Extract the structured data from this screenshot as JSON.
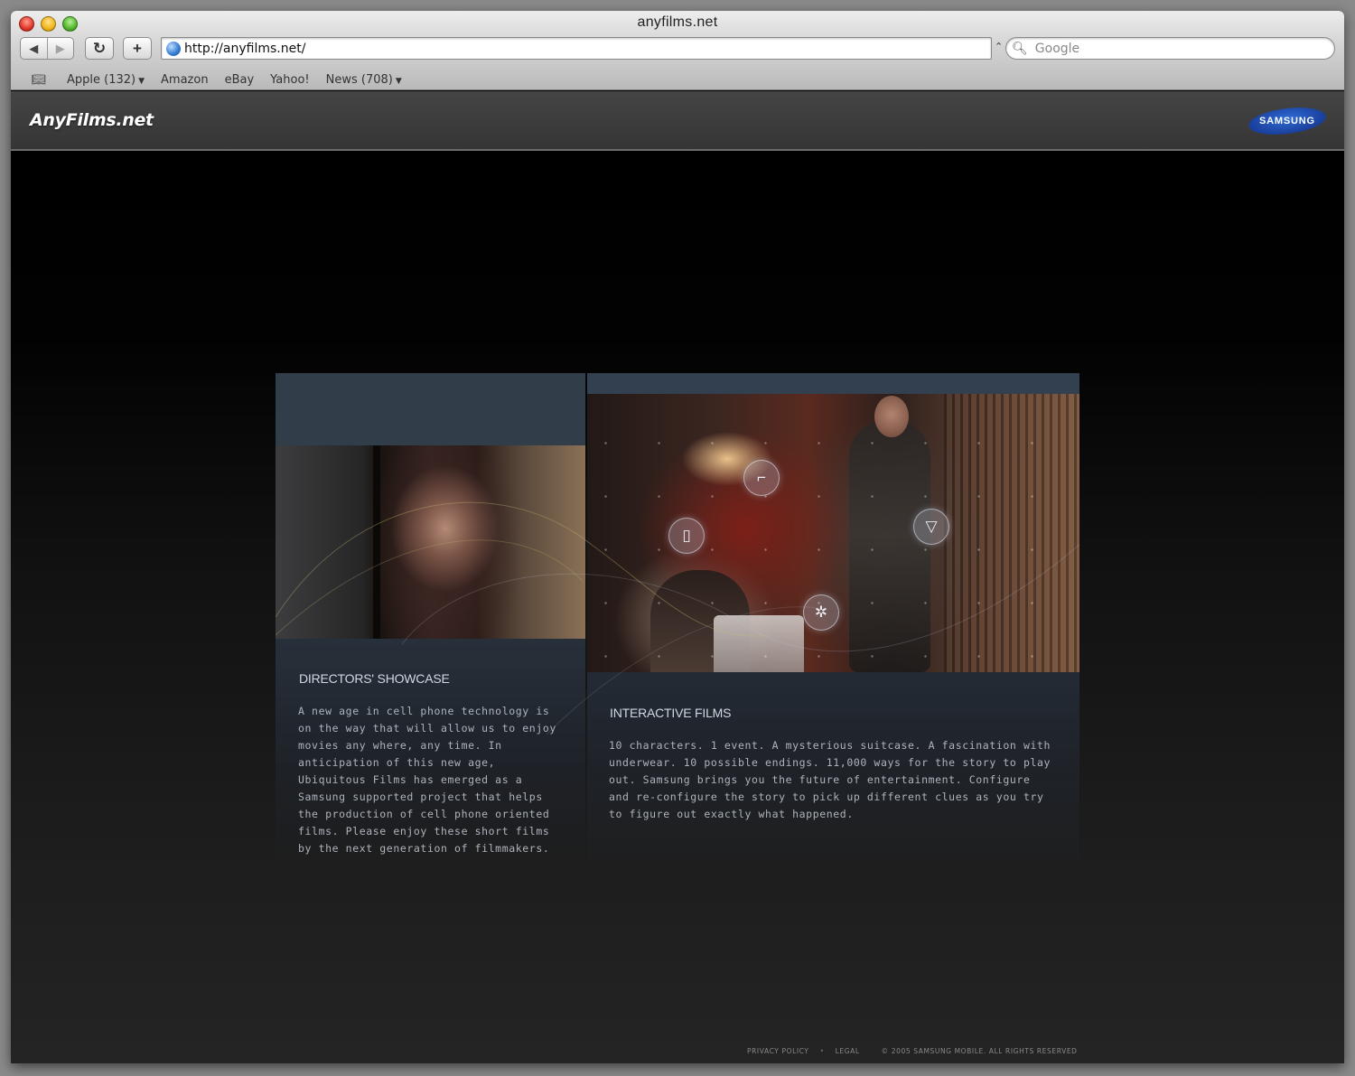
{
  "window": {
    "title": "anyfilms.net"
  },
  "toolbar": {
    "back_icon": "◀",
    "forward_icon": "▶",
    "reload_icon": "↻",
    "add_icon": "+",
    "url": "http://anyfilms.net/",
    "search_placeholder": "Google",
    "search_icon": "🔍︎"
  },
  "bookmarks": {
    "icon": "📖︎",
    "items": [
      {
        "label": "Apple (132)",
        "dropdown": true
      },
      {
        "label": "Amazon",
        "dropdown": false
      },
      {
        "label": "eBay",
        "dropdown": false
      },
      {
        "label": "Yahoo!",
        "dropdown": false
      },
      {
        "label": "News (708)",
        "dropdown": true
      }
    ]
  },
  "site": {
    "logo": "AnyFilms.net",
    "sponsor": "SAMSUNG"
  },
  "directors": {
    "title": "DIRECTORS' SHOWCASE",
    "body": "A new age in cell phone technology is on the way that will allow us to enjoy movies any where, any time. In anticipation of this new age, Ubiquitous Films has emerged as a Samsung supported project that helps the production of cell phone oriented films. Please enjoy these short films by the next generation of filmmakers."
  },
  "interactive": {
    "title": "INTERACTIVE FILMS",
    "body": "10 characters. 1 event. A mysterious suitcase. A fascination with underwear. 10 possible endings. 11,000 ways for the story to play out. Samsung brings you the future of entertainment. Configure and re-configure the story to pick up different clues as you try to figure out exactly what happened.",
    "hotspots": [
      "gun-icon",
      "phone-icon",
      "underwear-icon",
      "gear-icon"
    ]
  },
  "footer": {
    "privacy": "PRIVACY POLICY",
    "legal": "LEGAL",
    "copyright": "© 2005 SAMSUNG MOBILE. ALL RIGHTS RESERVED"
  },
  "colors": {
    "brand_blue": "#1f4ab4",
    "panel": "#303b48",
    "accent_text": "#cfd8e6"
  }
}
